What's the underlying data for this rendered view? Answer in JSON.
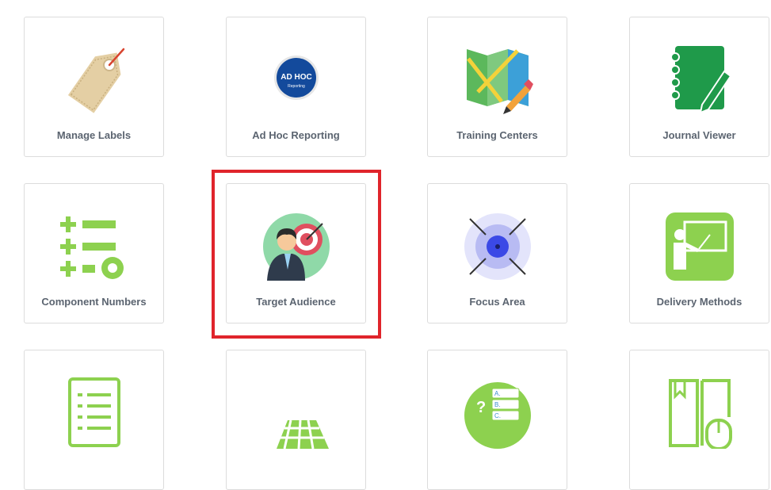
{
  "tiles": [
    {
      "label": "Manage Labels",
      "icon": "tag-icon"
    },
    {
      "label": "Ad Hoc Reporting",
      "icon": "ad-hoc-badge-icon",
      "badge_line1": "AD HOC",
      "badge_line2": "Reporting"
    },
    {
      "label": "Training Centers",
      "icon": "map-pencil-icon"
    },
    {
      "label": "Journal Viewer",
      "icon": "notebook-pencil-icon"
    },
    {
      "label": "Component Numbers",
      "icon": "plus-list-gear-icon"
    },
    {
      "label": "Target Audience",
      "icon": "person-target-icon"
    },
    {
      "label": "Focus Area",
      "icon": "focus-target-icon"
    },
    {
      "label": "Delivery Methods",
      "icon": "teacher-board-icon"
    },
    {
      "label": "",
      "icon": "checklist-icon"
    },
    {
      "label": "",
      "icon": "ruler-grid-icon"
    },
    {
      "label": "",
      "icon": "quiz-question-icon",
      "quiz_letters": [
        "A.",
        "B.",
        "C."
      ],
      "quiz_mark": "?"
    },
    {
      "label": "",
      "icon": "book-mouse-icon"
    }
  ],
  "highlight_color": "#e0242b"
}
